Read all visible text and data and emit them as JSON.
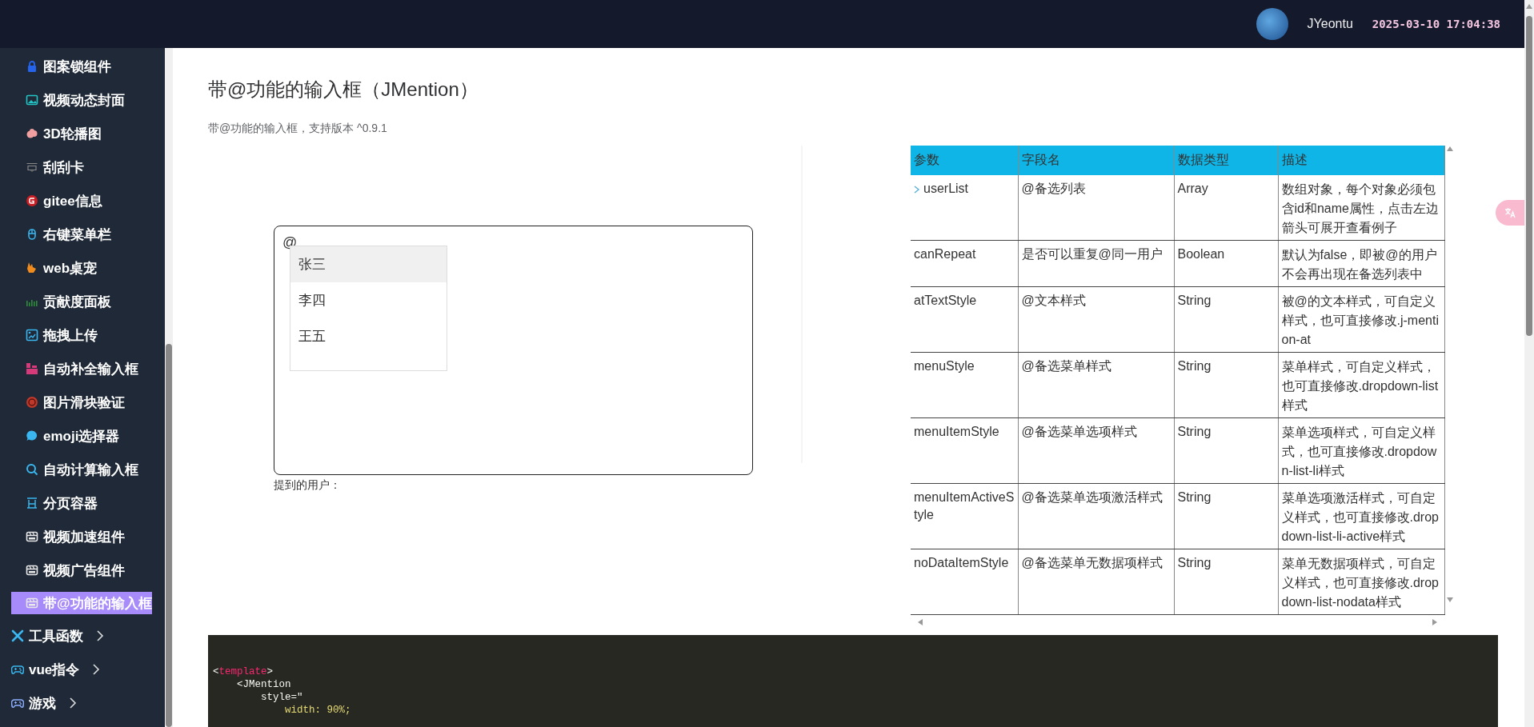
{
  "header": {
    "user_name": "JYeontu",
    "timestamp": "2025-03-10 17:04:38"
  },
  "sidebar": {
    "items": [
      {
        "label": "图案锁组件",
        "selected": false
      },
      {
        "label": "视频动态封面",
        "selected": false
      },
      {
        "label": "3D轮播图",
        "selected": false
      },
      {
        "label": "刮刮卡",
        "selected": false
      },
      {
        "label": "gitee信息",
        "selected": false
      },
      {
        "label": "右键菜单栏",
        "selected": false
      },
      {
        "label": "web桌宠",
        "selected": false
      },
      {
        "label": "贡献度面板",
        "selected": false
      },
      {
        "label": "拖拽上传",
        "selected": false
      },
      {
        "label": "自动补全输入框",
        "selected": false
      },
      {
        "label": "图片滑块验证",
        "selected": false
      },
      {
        "label": "emoji选择器",
        "selected": false
      },
      {
        "label": "自动计算输入框",
        "selected": false
      },
      {
        "label": "分页容器",
        "selected": false
      },
      {
        "label": "视频加速组件",
        "selected": false
      },
      {
        "label": "视频广告组件",
        "selected": false
      },
      {
        "label": "带@功能的输入框",
        "selected": true
      }
    ],
    "groups": [
      {
        "label": "工具函数",
        "expanded": false
      },
      {
        "label": "vue指令",
        "expanded": false
      },
      {
        "label": "游戏",
        "expanded": false
      }
    ]
  },
  "page": {
    "title": "带@功能的输入框（JMention）",
    "subtitle": "带@功能的输入框，支持版本 ^0.9.1"
  },
  "demo": {
    "value": "@",
    "options": [
      {
        "label": "张三",
        "selected": true
      },
      {
        "label": "李四",
        "selected": false
      },
      {
        "label": "王五",
        "selected": false
      }
    ],
    "mentioned_label": "提到的用户："
  },
  "table": {
    "columns": [
      "参数",
      "字段名",
      "数据类型",
      "描述"
    ],
    "rows": [
      {
        "param": "userList",
        "field": "@备选列表",
        "type": "Array",
        "desc": "数组对象，每个对象必须包含id和name属性，点击左边箭头可展开查看例子",
        "expandable": true
      },
      {
        "param": "canRepeat",
        "field": "是否可以重复@同一用户",
        "type": "Boolean",
        "desc": "默认为false，即被@的用户不会再出现在备选列表中",
        "expandable": false
      },
      {
        "param": "atTextStyle",
        "field": "@文本样式",
        "type": "String",
        "desc": "被@的文本样式，可自定义样式，也可直接修改.j-mention-at",
        "expandable": false
      },
      {
        "param": "menuStyle",
        "field": "@备选菜单样式",
        "type": "String",
        "desc": "菜单样式，可自定义样式，也可直接修改.dropdown-list样式",
        "expandable": false
      },
      {
        "param": "menuItemStyle",
        "field": "@备选菜单选项样式",
        "type": "String",
        "desc": "菜单选项样式，可自定义样式，也可直接修改.dropdown-list-li样式",
        "expandable": false
      },
      {
        "param": "menuItemActiveStyle",
        "field": "@备选菜单选项激活样式",
        "type": "String",
        "desc": "菜单选项激活样式，可自定义样式，也可直接修改.dropdown-list-li-active样式",
        "expandable": false
      },
      {
        "param": "noDataItemStyle",
        "field": "@备选菜单无数据项样式",
        "type": "String",
        "desc": "菜单无数据项样式，可自定义样式，也可直接修改.dropdown-list-nodata样式",
        "expandable": false
      }
    ]
  },
  "code": {
    "lines": [
      [
        {
          "text": "<",
          "kind": "punct"
        },
        {
          "text": "template",
          "kind": "tag"
        },
        {
          "text": ">",
          "kind": "punct"
        }
      ],
      [
        {
          "text": "    <JMention",
          "kind": "plain"
        }
      ],
      [
        {
          "text": "        style=\"",
          "kind": "plain"
        }
      ],
      [
        {
          "text": "            width: 90%;",
          "kind": "value"
        }
      ]
    ]
  }
}
